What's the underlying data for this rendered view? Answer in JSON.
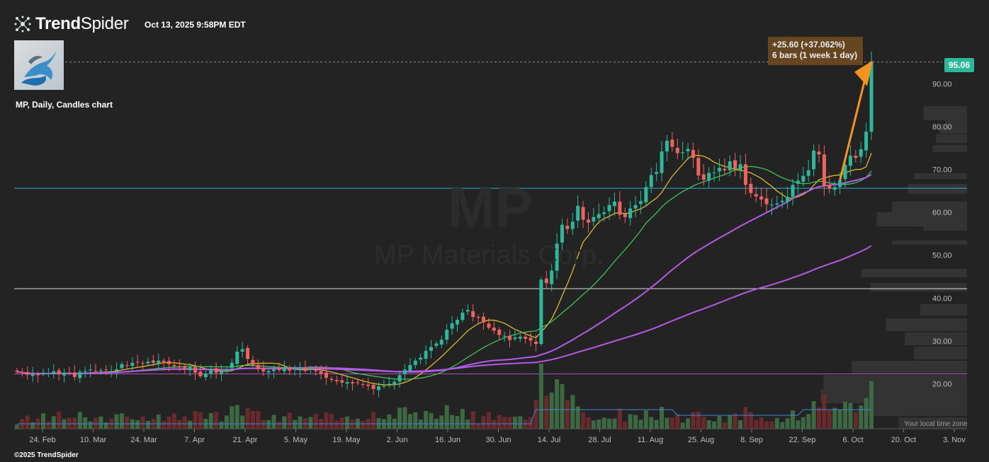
{
  "brand": {
    "name_bold": "Trend",
    "name_light": "Spider",
    "logo_icon": "spider-network-icon"
  },
  "timestamp": "Oct 13, 2025 9:58PM EDT",
  "chart_label": "MP, Daily, Candles chart",
  "watermark": {
    "symbol": "MP",
    "name": "MP Materials Corp."
  },
  "last_price": "95.06",
  "measure": {
    "change": "+25.60 (+37.062%)",
    "bars": "6 bars (1 week 1 day)"
  },
  "timezone_note": "Your local time zone",
  "copyright": "©2025 TrendSpider",
  "colors": {
    "up": "#2cb89a",
    "down": "#f0625f",
    "ma_yellow": "#e8c628",
    "ma_green": "#3fcf5a",
    "ma_purple": "#b45ae8",
    "hline_cyan": "#29c6e6",
    "hline_magenta": "#c35ad6",
    "arrow": "#f4931e"
  },
  "chart_data": {
    "type": "candlestick",
    "symbol": "MP",
    "interval": "Daily",
    "y_axis": {
      "ticks": [
        20,
        30,
        40,
        50,
        60,
        70,
        80,
        90
      ]
    },
    "x_axis": {
      "ticks": [
        "24. Feb",
        "10. Mar",
        "24. Mar",
        "7. Apr",
        "21. Apr",
        "5. May",
        "19. May",
        "2. Jun",
        "16. Jun",
        "30. Jun",
        "14. Jul",
        "28. Jul",
        "11. Aug",
        "25. Aug",
        "8. Sep",
        "22. Sep",
        "6. Oct",
        "20. Oct",
        "3. Nov"
      ]
    },
    "horizontal_lines": [
      {
        "price": 65.6,
        "color": "#29c6e6"
      },
      {
        "price": 42.2,
        "color": "#ffffff"
      },
      {
        "price": 22.3,
        "color": "#c35ad6"
      }
    ],
    "closes": [
      22.8,
      22.5,
      22.1,
      22.3,
      22.0,
      22.6,
      22.4,
      22.9,
      22.2,
      22.6,
      22.4,
      21.6,
      22.8,
      23.0,
      23.3,
      22.9,
      23.1,
      23.2,
      23.0,
      23.4,
      24.6,
      24.2,
      24.9,
      25.1,
      24.8,
      25.2,
      24.9,
      25.4,
      25.1,
      24.6,
      24.1,
      23.8,
      23.4,
      23.9,
      22.6,
      21.8,
      22.4,
      23.4,
      22.6,
      22.8,
      23.4,
      24.9,
      27.5,
      28.1,
      25.8,
      24.4,
      23.4,
      22.9,
      23.0,
      23.4,
      23.2,
      23.7,
      23.1,
      23.4,
      23.8,
      23.0,
      23.6,
      23.0,
      22.4,
      21.4,
      20.9,
      20.6,
      20.3,
      20.4,
      20.1,
      20.2,
      19.8,
      19.5,
      18.8,
      19.4,
      19.6,
      20.0,
      20.5,
      22.0,
      23.3,
      24.4,
      25.4,
      26.1,
      27.7,
      28.6,
      29.4,
      30.3,
      32.6,
      34.1,
      34.9,
      36.6,
      37.2,
      35.6,
      35.4,
      34.3,
      33.1,
      32.4,
      31.4,
      31.2,
      30.2,
      30.8,
      31.0,
      30.5,
      30.1,
      29.3,
      44.3,
      43.5,
      46.4,
      52.7,
      57.1,
      56.1,
      57.8,
      61.5,
      58.3,
      57.6,
      58.9,
      59.6,
      60.0,
      61.7,
      62.5,
      59.4,
      58.9,
      60.9,
      61.7,
      62.6,
      65.9,
      68.7,
      69.4,
      74.2,
      76.7,
      75.3,
      73.8,
      74.0,
      74.8,
      72.7,
      68.6,
      67.6,
      69.2,
      69.3,
      70.4,
      69.8,
      71.9,
      70.1,
      71.2,
      66.4,
      64.5,
      63.7,
      63.0,
      61.9,
      61.8,
      62.1,
      62.7,
      63.6,
      66.4,
      67.4,
      68.5,
      69.8,
      74.4,
      73.5,
      66.1,
      65.5,
      65.9,
      67.5,
      71.1,
      73.2,
      72.7,
      74.7,
      78.8,
      95.06
    ],
    "volume_note": "Daily volume bars colored by candle direction",
    "moving_averages": [
      {
        "color": "#e8c628",
        "period": 9
      },
      {
        "color": "#3fcf5a",
        "period": 21
      },
      {
        "color": "#b45ae8",
        "period": 50
      },
      {
        "color": "#b45ae8",
        "period": 100
      }
    ],
    "measurement": {
      "change": "+25.60 (+37.062%)",
      "bars": "6 bars (1 week 1 day)"
    }
  }
}
